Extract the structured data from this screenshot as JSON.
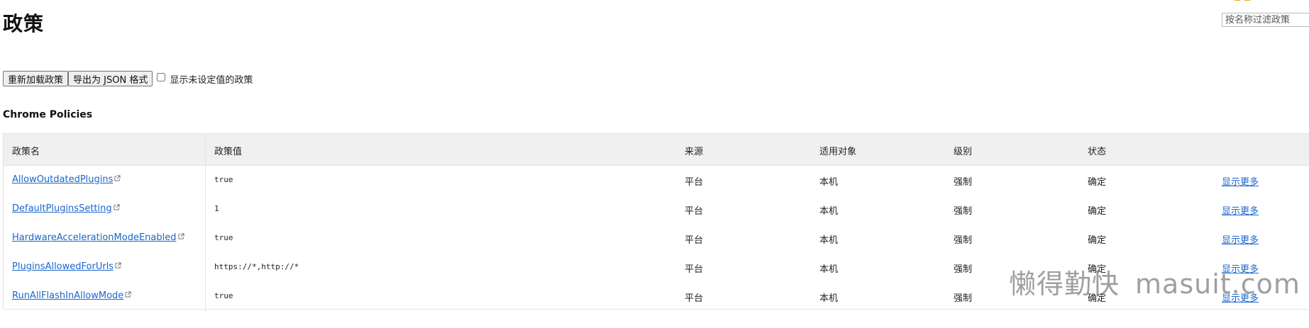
{
  "page": {
    "title": "政策",
    "filter_placeholder": "按名称过滤政策"
  },
  "toolbar": {
    "reload_label": "重新加载政策",
    "export_label": "导出为 JSON 格式",
    "show_unset_label": "显示未设定值的政策",
    "show_unset_checked": false
  },
  "section": {
    "title": "Chrome Policies"
  },
  "table": {
    "headers": {
      "name": "政策名",
      "value": "政策值",
      "source": "来源",
      "scope": "适用对象",
      "level": "级别",
      "status": "状态"
    },
    "rows": [
      {
        "name": "AllowOutdatedPlugins",
        "value": "true",
        "source": "平台",
        "scope": "本机",
        "level": "强制",
        "status": "确定",
        "more": "显示更多"
      },
      {
        "name": "DefaultPluginsSetting",
        "value": "1",
        "source": "平台",
        "scope": "本机",
        "level": "强制",
        "status": "确定",
        "more": "显示更多"
      },
      {
        "name": "HardwareAccelerationModeEnabled",
        "value": "true",
        "source": "平台",
        "scope": "本机",
        "level": "强制",
        "status": "确定",
        "more": "显示更多"
      },
      {
        "name": "PluginsAllowedForUrls",
        "value": "https://*,http://*",
        "source": "平台",
        "scope": "本机",
        "level": "强制",
        "status": "确定",
        "more": "显示更多"
      },
      {
        "name": "RunAllFlashInAllowMode",
        "value": "true",
        "source": "平台",
        "scope": "本机",
        "level": "强制",
        "status": "确定",
        "more": "显示更多"
      }
    ]
  },
  "watermark": {
    "cn": "懒得勤快",
    "en": "masuit.com"
  },
  "colors": {
    "link": "#1a66cc",
    "header_bg": "#f0f0f0",
    "border": "#e3e3e3"
  }
}
